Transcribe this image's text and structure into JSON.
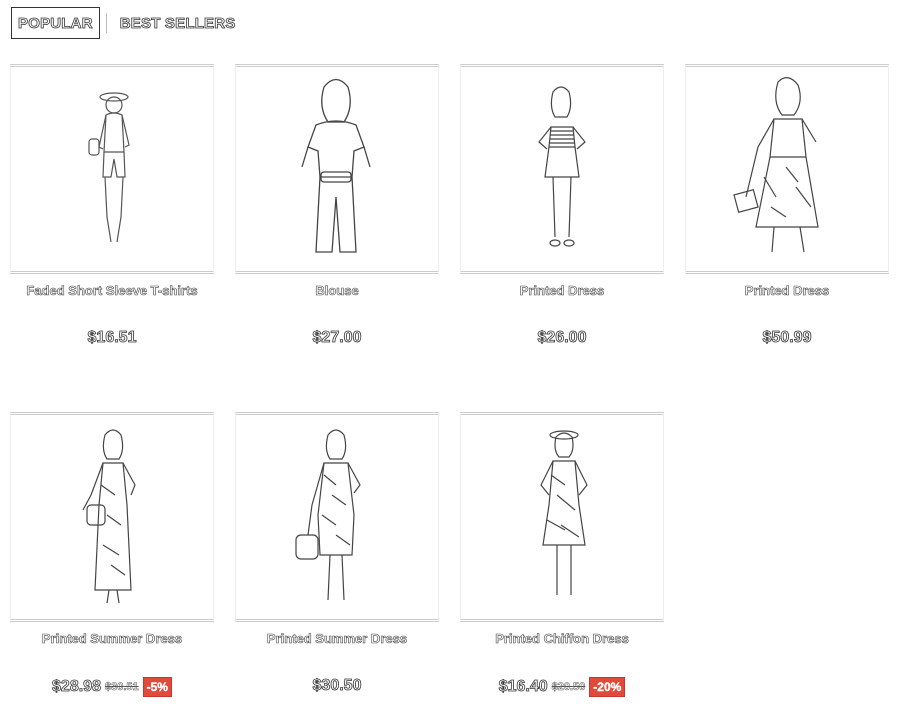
{
  "tabs": [
    {
      "label": "POPULAR",
      "active": true
    },
    {
      "label": "BEST SELLERS",
      "active": false
    }
  ],
  "products": [
    {
      "name": "Faded Short Sleeve T-shirts",
      "price": "$16.51",
      "old_price": "",
      "discount": ""
    },
    {
      "name": "Blouse",
      "price": "$27.00",
      "old_price": "",
      "discount": ""
    },
    {
      "name": "Printed Dress",
      "price": "$26.00",
      "old_price": "",
      "discount": ""
    },
    {
      "name": "Printed Dress",
      "price": "$50.99",
      "old_price": "",
      "discount": ""
    },
    {
      "name": "Printed Summer Dress",
      "price": "$28.98",
      "old_price": "$30.51",
      "discount": "-5%"
    },
    {
      "name": "Printed Summer Dress",
      "price": "$30.50",
      "old_price": "",
      "discount": ""
    },
    {
      "name": "Printed Chiffon Dress",
      "price": "$16.40",
      "old_price": "$20.50",
      "discount": "-20%"
    }
  ],
  "colors": {
    "discount_bg": "#e04a3a",
    "border": "#cccccc"
  }
}
